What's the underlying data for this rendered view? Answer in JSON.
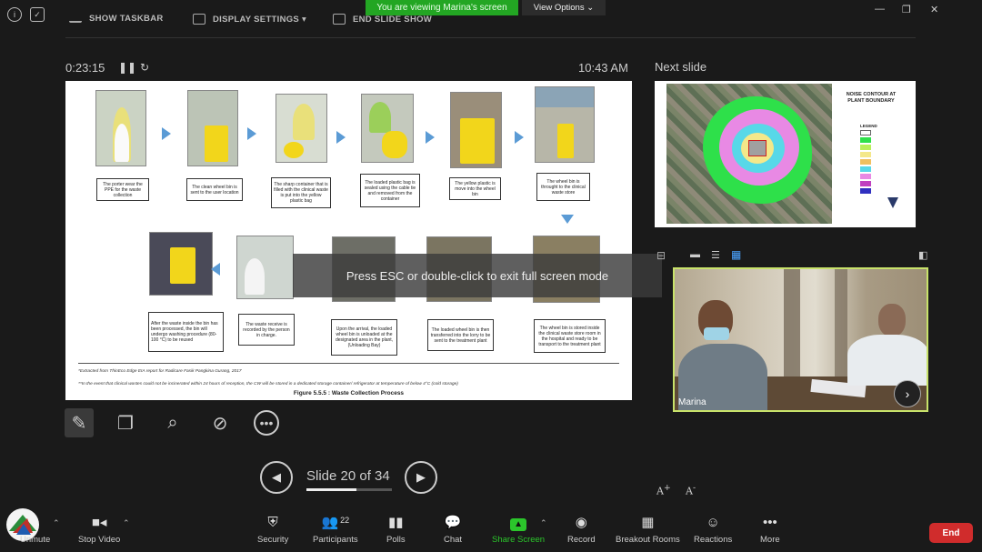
{
  "topbar": {
    "show_taskbar": "SHOW TASKBAR",
    "display_settings": "DISPLAY SETTINGS ▾",
    "end_slide_show": "END SLIDE SHOW",
    "viewing_banner": "You are viewing Marina's screen",
    "view_options": "View Options ⌄"
  },
  "presenter": {
    "elapsed": "0:23:15",
    "clock": "10:43 AM",
    "next_slide_label": "Next slide",
    "slide_counter": "Slide 20 of 34",
    "current_slide": 20,
    "total_slides": 34
  },
  "slide": {
    "steps_row1": [
      "The porter wear the PPE for the waste collection",
      "The clean wheel bin is sent to the user location",
      "The sharp container that is filled with the clinical waste is put into the yellow plastic bag",
      "The loaded plastic bag is sealed using the cable tie and removed from the container",
      "The yellow plastic is move into the wheel bin",
      "The wheel bin is throught to the clinical waste store"
    ],
    "steps_row2": [
      "After the waste inside the bin has been processed, the bin will undergo washing procedure (80-100 °C) to be reused",
      "The waste receive is recorded by the person in charge.",
      "Upon the arrival, the loaded wheel bin is unloaded at the designated area in the plant, (Unloading Bay)",
      "The loaded wheel bin is then transferred into the lorry to be sent to the treatment plant",
      "The wheel bin is stored inside the clinical waste store room in the hospital and ready to be transport to the treatment plant"
    ],
    "footnote1": "*Extracted from ThinEco Edge EIA report for Radicare Fasik Pangkina Gurang, 2017",
    "footnote2": "**In the event that clinical wastes could not be incinerated within 24 hours of reception, the CW will be stored in a dedicated storage container/ refrigerator at temperature of below 4°C (cold storage)",
    "figure_caption": "Figure 5.5.5 :  Waste Collection Process"
  },
  "overlay_message": "Press ESC or double-click to exit full screen mode",
  "next_slide": {
    "title": "NOISE CONTOUR AT PLANT BOUNDARY",
    "legend_title": "LEGEND"
  },
  "video": {
    "participant_name": "Marina"
  },
  "toolbar": {
    "mute": "Unmute",
    "stop_video": "Stop Video",
    "security": "Security",
    "participants": "Participants",
    "participants_count": "22",
    "polls": "Polls",
    "chat": "Chat",
    "share_screen": "Share Screen",
    "record": "Record",
    "breakout_rooms": "Breakout Rooms",
    "reactions": "Reactions",
    "more": "More",
    "end": "End"
  },
  "colors": {
    "share_green": "#2bc52b",
    "banner_green": "#23a623",
    "end_red": "#d02c2c",
    "video_border": "#c8e26a"
  }
}
